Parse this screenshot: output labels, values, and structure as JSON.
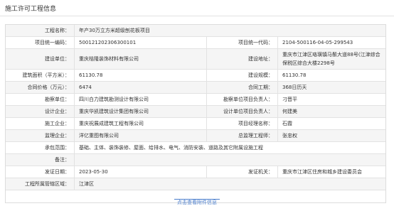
{
  "dialog": {
    "title": "施工许可工程信息"
  },
  "rows": [
    {
      "label": "工程名称：",
      "value": "年产30万立方米超级刨花板项目"
    },
    {
      "l1": "项目统一编码：",
      "v1": "500121202306300101",
      "l2": "项目统一代码：",
      "v2": "2104-500116-04-05-299543"
    },
    {
      "l1": "建设单位：",
      "v1": "重庆桔隆装饰材料有限公司",
      "l2": "建设地址：",
      "v2": "重庆市江津区珞璜镇马鬃大道88号(江津综合保税区综合大楼2298号"
    },
    {
      "l1": "建筑面积（平方米）：",
      "v1": "61130.78",
      "l2": "建设规模：",
      "v2": "61130.78"
    },
    {
      "l1": "合同价格（万元）：",
      "v1": "6474",
      "l2": "合同工期：",
      "v2": "368日历天"
    },
    {
      "l1": "勘察单位：",
      "v1": "四川白力建筑勘测设计有限公司",
      "l2": "勘察单位项目负责人：",
      "v2": "刁晋平"
    },
    {
      "l1": "设计企业：",
      "v1": "重庆华凯建筑设计集团有限公司",
      "l2": "设计单位项目负责人：",
      "v2": "何建美"
    },
    {
      "l1": "施工企业：",
      "v1": "重庆祝展成建筑工程有限公司",
      "l2": "项目经理名称：",
      "v2": "石霞"
    },
    {
      "l1": "监理企业：",
      "v1": "洋亿重图有限公司",
      "l2": "总监理工程师：",
      "v2": "张忠权"
    },
    {
      "label": "承包范围：",
      "value": "基础、主体、装饰装修、屋面、给排水、电气、消防安装、道路及其它附属设施工程"
    },
    {
      "label": "备注：",
      "value": ""
    },
    {
      "l1": "发证日期：",
      "v1": "2023-05-30",
      "l2": "发证机关：",
      "v2": "重庆市江津区住房和城乡建设委员会"
    },
    {
      "label": "工程所属管辖区域：",
      "value": "江津区"
    }
  ],
  "more_link": "点击查看附件信息"
}
